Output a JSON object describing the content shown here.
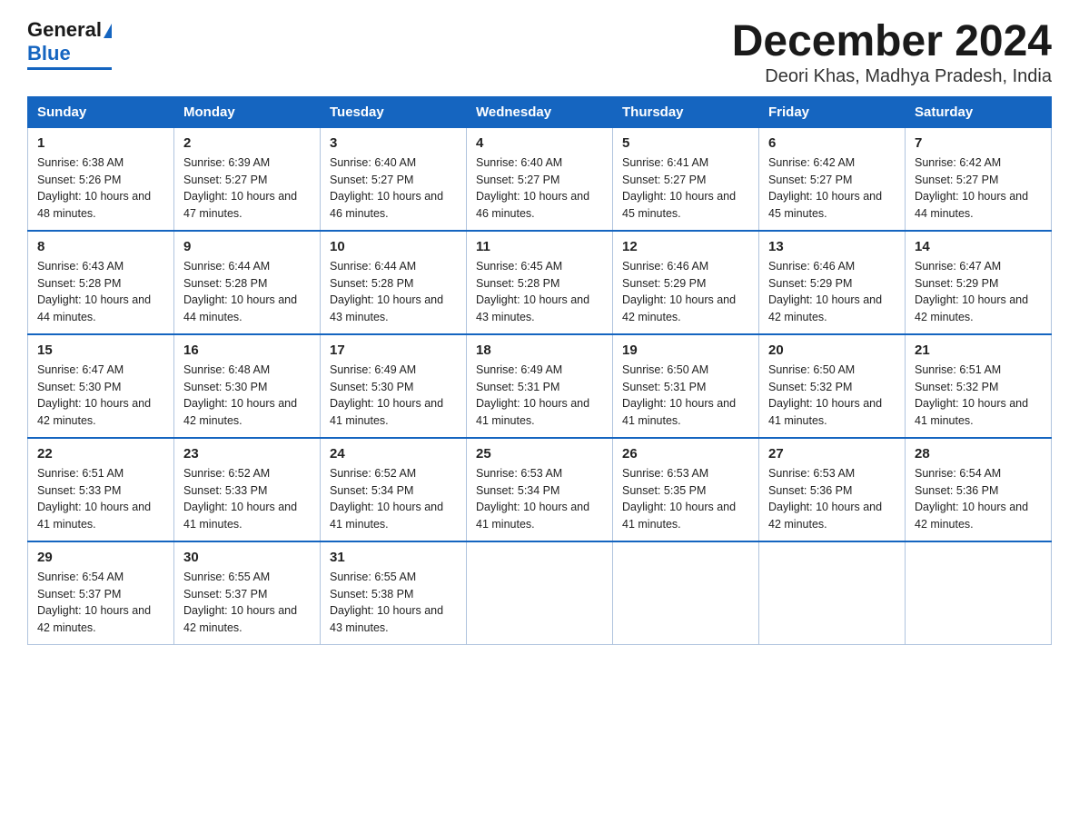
{
  "header": {
    "logo_general": "General",
    "logo_blue": "Blue",
    "title": "December 2024",
    "subtitle": "Deori Khas, Madhya Pradesh, India"
  },
  "days_of_week": [
    "Sunday",
    "Monday",
    "Tuesday",
    "Wednesday",
    "Thursday",
    "Friday",
    "Saturday"
  ],
  "weeks": [
    [
      {
        "day": "1",
        "sunrise": "6:38 AM",
        "sunset": "5:26 PM",
        "daylight": "10 hours and 48 minutes."
      },
      {
        "day": "2",
        "sunrise": "6:39 AM",
        "sunset": "5:27 PM",
        "daylight": "10 hours and 47 minutes."
      },
      {
        "day": "3",
        "sunrise": "6:40 AM",
        "sunset": "5:27 PM",
        "daylight": "10 hours and 46 minutes."
      },
      {
        "day": "4",
        "sunrise": "6:40 AM",
        "sunset": "5:27 PM",
        "daylight": "10 hours and 46 minutes."
      },
      {
        "day": "5",
        "sunrise": "6:41 AM",
        "sunset": "5:27 PM",
        "daylight": "10 hours and 45 minutes."
      },
      {
        "day": "6",
        "sunrise": "6:42 AM",
        "sunset": "5:27 PM",
        "daylight": "10 hours and 45 minutes."
      },
      {
        "day": "7",
        "sunrise": "6:42 AM",
        "sunset": "5:27 PM",
        "daylight": "10 hours and 44 minutes."
      }
    ],
    [
      {
        "day": "8",
        "sunrise": "6:43 AM",
        "sunset": "5:28 PM",
        "daylight": "10 hours and 44 minutes."
      },
      {
        "day": "9",
        "sunrise": "6:44 AM",
        "sunset": "5:28 PM",
        "daylight": "10 hours and 44 minutes."
      },
      {
        "day": "10",
        "sunrise": "6:44 AM",
        "sunset": "5:28 PM",
        "daylight": "10 hours and 43 minutes."
      },
      {
        "day": "11",
        "sunrise": "6:45 AM",
        "sunset": "5:28 PM",
        "daylight": "10 hours and 43 minutes."
      },
      {
        "day": "12",
        "sunrise": "6:46 AM",
        "sunset": "5:29 PM",
        "daylight": "10 hours and 42 minutes."
      },
      {
        "day": "13",
        "sunrise": "6:46 AM",
        "sunset": "5:29 PM",
        "daylight": "10 hours and 42 minutes."
      },
      {
        "day": "14",
        "sunrise": "6:47 AM",
        "sunset": "5:29 PM",
        "daylight": "10 hours and 42 minutes."
      }
    ],
    [
      {
        "day": "15",
        "sunrise": "6:47 AM",
        "sunset": "5:30 PM",
        "daylight": "10 hours and 42 minutes."
      },
      {
        "day": "16",
        "sunrise": "6:48 AM",
        "sunset": "5:30 PM",
        "daylight": "10 hours and 42 minutes."
      },
      {
        "day": "17",
        "sunrise": "6:49 AM",
        "sunset": "5:30 PM",
        "daylight": "10 hours and 41 minutes."
      },
      {
        "day": "18",
        "sunrise": "6:49 AM",
        "sunset": "5:31 PM",
        "daylight": "10 hours and 41 minutes."
      },
      {
        "day": "19",
        "sunrise": "6:50 AM",
        "sunset": "5:31 PM",
        "daylight": "10 hours and 41 minutes."
      },
      {
        "day": "20",
        "sunrise": "6:50 AM",
        "sunset": "5:32 PM",
        "daylight": "10 hours and 41 minutes."
      },
      {
        "day": "21",
        "sunrise": "6:51 AM",
        "sunset": "5:32 PM",
        "daylight": "10 hours and 41 minutes."
      }
    ],
    [
      {
        "day": "22",
        "sunrise": "6:51 AM",
        "sunset": "5:33 PM",
        "daylight": "10 hours and 41 minutes."
      },
      {
        "day": "23",
        "sunrise": "6:52 AM",
        "sunset": "5:33 PM",
        "daylight": "10 hours and 41 minutes."
      },
      {
        "day": "24",
        "sunrise": "6:52 AM",
        "sunset": "5:34 PM",
        "daylight": "10 hours and 41 minutes."
      },
      {
        "day": "25",
        "sunrise": "6:53 AM",
        "sunset": "5:34 PM",
        "daylight": "10 hours and 41 minutes."
      },
      {
        "day": "26",
        "sunrise": "6:53 AM",
        "sunset": "5:35 PM",
        "daylight": "10 hours and 41 minutes."
      },
      {
        "day": "27",
        "sunrise": "6:53 AM",
        "sunset": "5:36 PM",
        "daylight": "10 hours and 42 minutes."
      },
      {
        "day": "28",
        "sunrise": "6:54 AM",
        "sunset": "5:36 PM",
        "daylight": "10 hours and 42 minutes."
      }
    ],
    [
      {
        "day": "29",
        "sunrise": "6:54 AM",
        "sunset": "5:37 PM",
        "daylight": "10 hours and 42 minutes."
      },
      {
        "day": "30",
        "sunrise": "6:55 AM",
        "sunset": "5:37 PM",
        "daylight": "10 hours and 42 minutes."
      },
      {
        "day": "31",
        "sunrise": "6:55 AM",
        "sunset": "5:38 PM",
        "daylight": "10 hours and 43 minutes."
      },
      {
        "day": "",
        "sunrise": "",
        "sunset": "",
        "daylight": ""
      },
      {
        "day": "",
        "sunrise": "",
        "sunset": "",
        "daylight": ""
      },
      {
        "day": "",
        "sunrise": "",
        "sunset": "",
        "daylight": ""
      },
      {
        "day": "",
        "sunrise": "",
        "sunset": "",
        "daylight": ""
      }
    ]
  ]
}
